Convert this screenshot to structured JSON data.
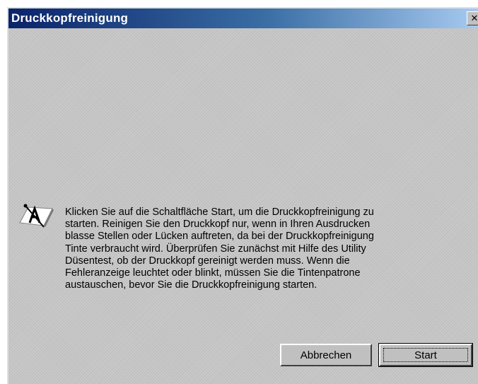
{
  "window": {
    "title": "Druckkopfreinigung"
  },
  "titlebar": {
    "close_glyph": "✕"
  },
  "message": {
    "icon": "info-icon",
    "text": "Klicken Sie auf die Schaltfläche Start, um die Druckkopfreinigung zu\nstarten. Reinigen Sie den Druckkopf nur, wenn in Ihren Ausdrucken\nblasse Stellen oder Lücken auftreten, da bei der Druckkopfreinigung\nTinte verbraucht wird. Überprüfen Sie zunächst mit Hilfe des Utility\nDüsentest, ob der Druckkopf gereinigt werden muss. Wenn die\nFehleranzeige leuchtet oder blinkt, müssen Sie die Tintenpatrone\naustauschen, bevor Sie die Druckkopfreinigung starten."
  },
  "buttons": {
    "cancel_label": "Abbrechen",
    "start_label": "Start"
  },
  "colors": {
    "titlebar_start": "#0a246a",
    "titlebar_end": "#a6caf0",
    "dialog_face": "#c0c0c0"
  }
}
